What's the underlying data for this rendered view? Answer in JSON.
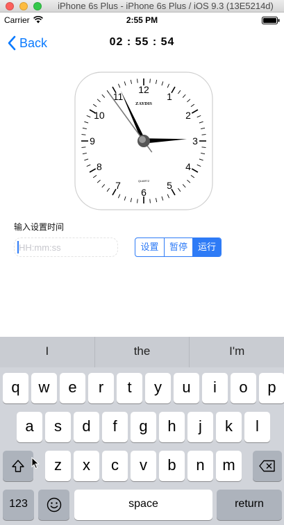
{
  "window": {
    "title": "iPhone 6s Plus - iPhone 6s Plus / iOS 9.3 (13E5214d)"
  },
  "status_bar": {
    "carrier": "Carrier",
    "time": "2:55 PM"
  },
  "nav": {
    "back_label": "Back",
    "title": "02 : 55 : 54"
  },
  "clock": {
    "brand": "ZAYDIS",
    "movement": "QUARTZ",
    "numerals": [
      "12",
      "1",
      "2",
      "3",
      "4",
      "5",
      "6",
      "7",
      "8",
      "9",
      "10",
      "11"
    ],
    "hours": 2,
    "minutes": 55,
    "seconds": 54
  },
  "form": {
    "label": "输入设置时间",
    "input_placeholder": "HH:mm:ss",
    "input_value": "",
    "buttons": [
      "设置",
      "暂停",
      "运行"
    ],
    "active_button": "运行"
  },
  "keyboard": {
    "suggestions": [
      "I",
      "the",
      "I'm"
    ],
    "row1": [
      "q",
      "w",
      "e",
      "r",
      "t",
      "y",
      "u",
      "i",
      "o",
      "p"
    ],
    "row2": [
      "a",
      "s",
      "d",
      "f",
      "g",
      "h",
      "j",
      "k",
      "l"
    ],
    "row3": [
      "z",
      "x",
      "c",
      "v",
      "b",
      "n",
      "m"
    ],
    "numbers_key": "123",
    "space_key": "space",
    "return_key": "return"
  },
  "colors": {
    "accent": "#0a7aff",
    "segment": "#2e7bf6",
    "keyboard_bg": "#d1d4da"
  }
}
